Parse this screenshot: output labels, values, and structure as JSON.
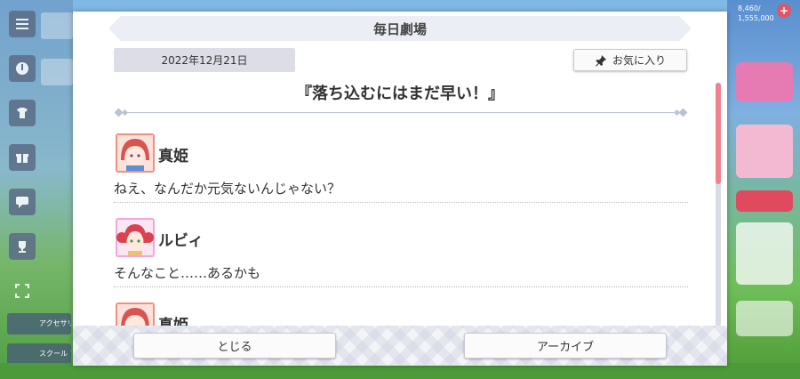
{
  "background": {
    "left_labels": [
      "アクセサリー",
      "スクール アイドル"
    ],
    "top_right_counter": [
      "8,460/",
      "1,555,000"
    ]
  },
  "dialog": {
    "title": "毎日劇場",
    "date": "2022年12月21日",
    "favorite_label": "お気に入り",
    "story_title": "『落ち込むにはまだ早い！』",
    "entries": [
      {
        "speaker": "真姫",
        "text": "ねえ、なんだか元気ないんじゃない？",
        "avatar_color": "#e8766f"
      },
      {
        "speaker": "ルビィ",
        "text": "そんなこと……あるかも",
        "avatar_color": "#f08fc8"
      },
      {
        "speaker": "真姫",
        "text": "",
        "avatar_color": "#e8766f"
      }
    ],
    "close_label": "とじる",
    "archive_label": "アーカイブ"
  },
  "colors": {
    "scrollbar_thumb": "#f0828f",
    "banner_bg": "#ebeef5",
    "date_bg": "#dcdde6"
  },
  "scroll_position": 0
}
